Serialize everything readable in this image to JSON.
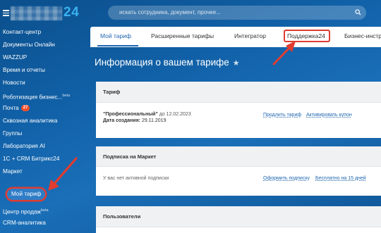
{
  "header": {
    "logo_suffix": "24",
    "search_placeholder": "искать сотрудника, документ, прочее..."
  },
  "sidebar": {
    "items": [
      {
        "label": "Контакт-центр"
      },
      {
        "label": "Документы Онлайн"
      },
      {
        "label": "WAZZUP"
      },
      {
        "label": "Время и отчеты"
      },
      {
        "label": "Новости"
      },
      {
        "label": "Роботизация бизнес...",
        "suffix": "beta"
      },
      {
        "label": "Почта",
        "badge": "27"
      },
      {
        "label": "Сквозная аналитика"
      },
      {
        "label": "Группы"
      },
      {
        "label": "Лаборатория AI"
      },
      {
        "label": "1С + CRM Битрикс24"
      },
      {
        "label": "Маркет"
      },
      {
        "label": "Мой тариф",
        "active": true
      },
      {
        "label": "Центр продаж",
        "suffix": "beta"
      },
      {
        "label": "CRM-аналитика"
      }
    ]
  },
  "tabs": [
    {
      "label": "Мой тариф",
      "active": true
    },
    {
      "label": "Расширенные тарифы"
    },
    {
      "label": "Интегратор"
    },
    {
      "label": "Поддержка24",
      "highlighted": true
    },
    {
      "label": "Бизнес-инстр"
    }
  ],
  "page": {
    "title": "Информация о вашем тарифе"
  },
  "tariff_card": {
    "header": "Тариф",
    "plan_name": "\"Профессиональный\"",
    "plan_until": " до 12.02.2023",
    "created_label": "Дата создания:",
    "created_value": " 29.11.2019",
    "extend_link": "Продлить тариф",
    "coupon_link": "Активировать купон"
  },
  "market_card": {
    "header": "Подписка на Маркет",
    "no_sub": "У вас нет активной подписки",
    "subscribe_link": "Оформить подписку",
    "free_link": "Бесплатно на 15 дней"
  },
  "users_card": {
    "header": "Пользователи"
  },
  "colors": {
    "accent": "#2067b0",
    "highlight": "#e03c30",
    "logo": "#3ab1ef",
    "badge": "#f04e2a"
  }
}
